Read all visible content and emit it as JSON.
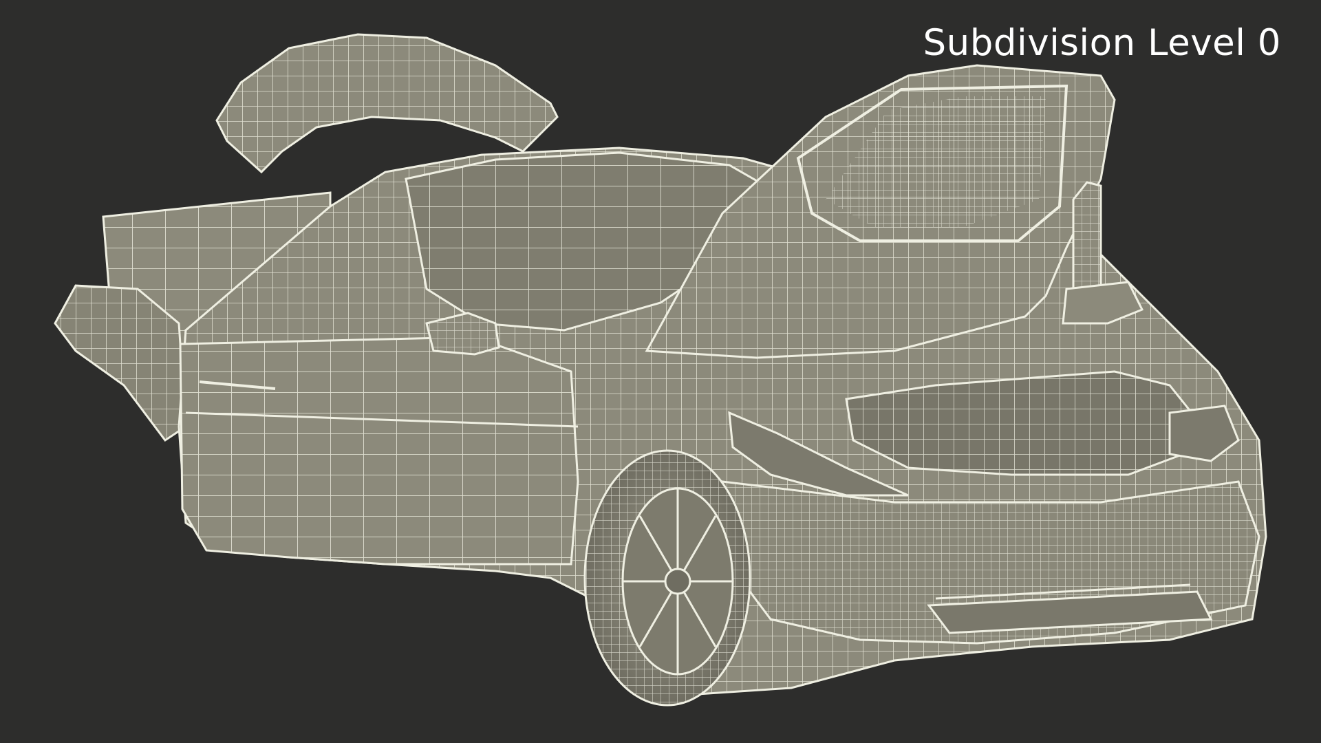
{
  "viewport": {
    "label": "Subdivision Level 0",
    "background_color": "#2d2d2c",
    "mesh_fill_color": "#8c8a7b",
    "mesh_wire_color": "#efefe2"
  },
  "model": {
    "subject": "car-3d-wireframe-model",
    "state": "doors-open-hood-open"
  }
}
